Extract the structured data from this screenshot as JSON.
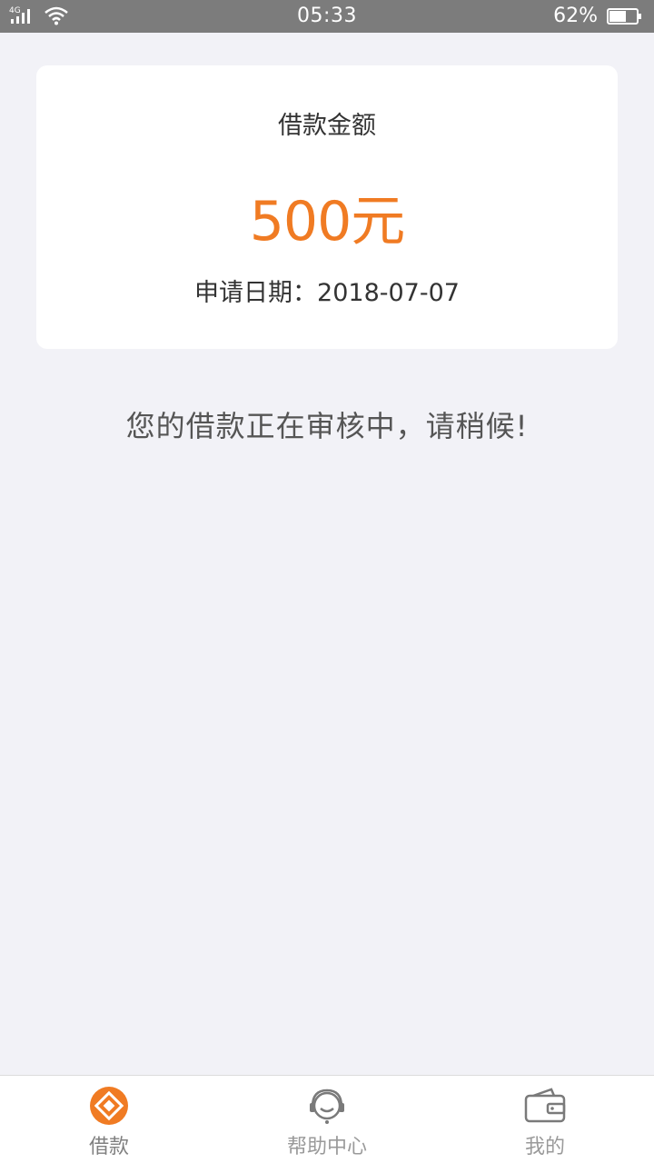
{
  "status_bar": {
    "network": "4G",
    "time": "05:33",
    "battery": "62%",
    "battery_level": 0.62
  },
  "loan_card": {
    "title": "借款金额",
    "amount": "500元",
    "date_label": "申请日期：",
    "date_value": "2018-07-07"
  },
  "message": "您的借款正在审核中，请稍候!",
  "tabs": [
    {
      "label": "借款",
      "icon": "loan-icon",
      "active": true
    },
    {
      "label": "帮助中心",
      "icon": "customer-service-icon",
      "active": false
    },
    {
      "label": "我的",
      "icon": "wallet-icon",
      "active": false
    }
  ],
  "colors": {
    "accent": "#f07b23",
    "background": "#f2f2f7",
    "status_bar": "#7c7c7c"
  }
}
